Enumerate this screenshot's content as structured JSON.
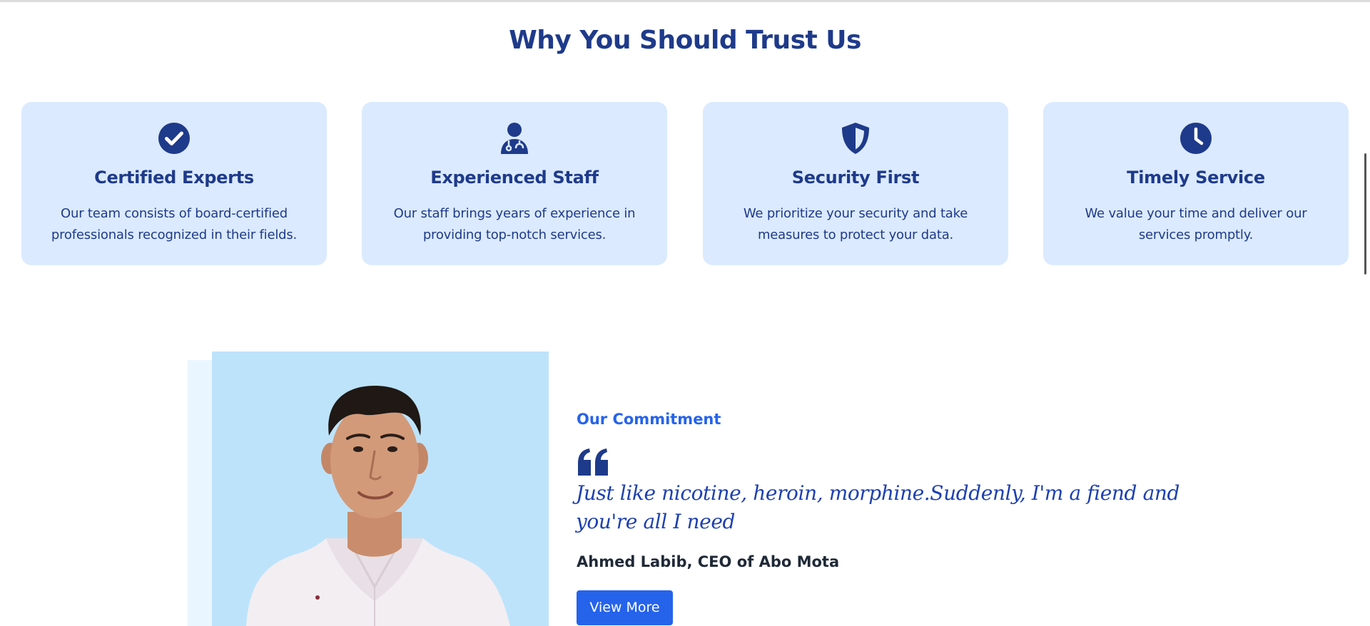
{
  "section": {
    "title": "Why You Should Trust Us"
  },
  "cards": [
    {
      "icon": "check-circle-icon",
      "title": "Certified Experts",
      "description": "Our team consists of board-certified professionals recognized in their fields."
    },
    {
      "icon": "doctor-icon",
      "title": "Experienced Staff",
      "description": "Our staff brings years of experience in providing top-notch services."
    },
    {
      "icon": "shield-icon",
      "title": "Security First",
      "description": "We prioritize your security and take measures to protect your data."
    },
    {
      "icon": "clock-icon",
      "title": "Timely Service",
      "description": "We value your time and deliver our services promptly."
    }
  ],
  "commitment": {
    "label": "Our Commitment",
    "quote_icon": "quote-left-icon",
    "quote": "Just like nicotine, heroin, morphine.Suddenly, I'm a fiend and you're all I need",
    "author": "Ahmed Labib, CEO of Abo Mota",
    "button_label": "View More",
    "photo": "portrait-photo"
  },
  "colors": {
    "primary_dark": "#1e3a8a",
    "accent_blue": "#2563eb",
    "card_bg": "#dbeafe",
    "photo_bg": "#bde3fb"
  }
}
